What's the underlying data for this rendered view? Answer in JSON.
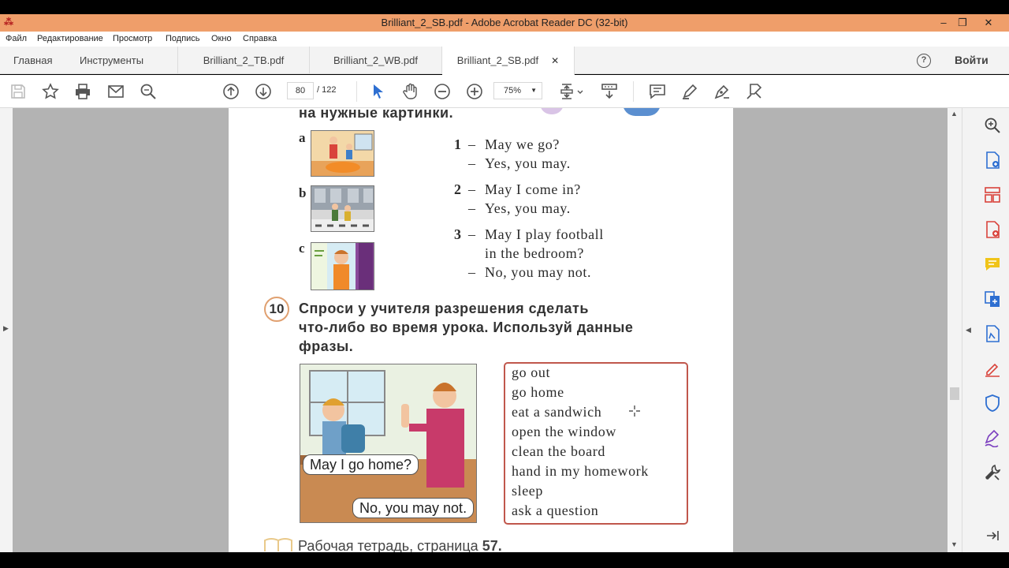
{
  "window": {
    "title": "Brilliant_2_SB.pdf - Adobe Acrobat Reader DC (32-bit)",
    "minimize": "–",
    "restore": "❐",
    "close": "✕"
  },
  "menu": [
    "Файл",
    "Редактирование",
    "Просмотр",
    "Подпись",
    "Окно",
    "Справка"
  ],
  "tabs": {
    "home": "Главная",
    "tools": "Инструменты",
    "docs": [
      "Brilliant_2_TB.pdf",
      "Brilliant_2_WB.pdf",
      "Brilliant_2_SB.pdf"
    ],
    "close_glyph": "✕",
    "help": "?",
    "signin": "Войти"
  },
  "toolbar": {
    "page_current": "80",
    "page_total": "/  122",
    "zoom": "75%",
    "zoom_arrow": "▼"
  },
  "document": {
    "heading_top": "на нужные картинки.",
    "pic_labels": [
      "a",
      "b",
      "c"
    ],
    "dialog_1": {
      "number": "1",
      "dash": "–",
      "lines": [
        "May we go?",
        "Yes, you may."
      ]
    },
    "dialog_2": {
      "number": "2",
      "dash": "–",
      "lines": [
        "May I come in?",
        "Yes, you may."
      ]
    },
    "dialog_3": {
      "number": "3",
      "dash": "–",
      "lines": [
        "May I play football",
        "in the bedroom?",
        "No, you may not."
      ]
    },
    "exercise_number": "10",
    "exercise_text": [
      "Спроси у учителя разрешения сделать",
      "что-либо во время урока. Используй данные",
      "фразы."
    ],
    "bubble_student": "May I go home?",
    "bubble_teacher": "No, you may not.",
    "phrases": [
      "go out",
      "go home",
      "eat a sandwich",
      "open the window",
      "clean the board",
      "hand in my homework",
      "sleep",
      "ask a question"
    ],
    "footer": "Рабочая тетрадь, страница",
    "footer_page": "57."
  },
  "colors": {
    "titlebar": "#ef9e6a",
    "box_border": "#c0574c",
    "sidebar_icon_blue": "#2e6fd1",
    "sidebar_icon_red": "#d9443c",
    "sidebar_icon_yellow": "#f0c419",
    "sidebar_icon_purple": "#7b3fbf"
  }
}
